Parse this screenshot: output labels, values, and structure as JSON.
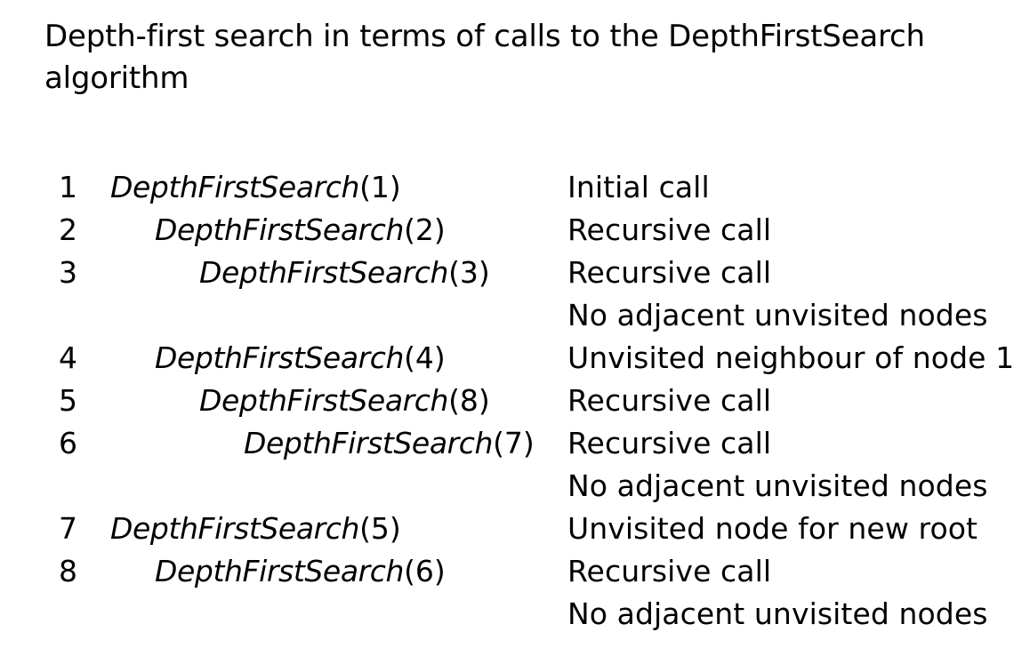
{
  "title": "Depth-first search in terms of calls to the DepthFirstSearch algorithm",
  "rows": [
    {
      "num": "1",
      "fn": "DepthFirstSearch",
      "arg": "(1)",
      "note": "Initial call"
    },
    {
      "num": "2",
      "fn": "DepthFirstSearch",
      "arg": "(2)",
      "note": "Recursive call"
    },
    {
      "num": "3",
      "fn": "DepthFirstSearch",
      "arg": "(3)",
      "note": "Recursive call"
    },
    {
      "note": "No adjacent unvisited nodes"
    },
    {
      "num": "4",
      "fn": "DepthFirstSearch",
      "arg": "(4)",
      "note": "Unvisited neighbour of node 1"
    },
    {
      "num": "5",
      "fn": "DepthFirstSearch",
      "arg": "(8)",
      "note": "Recursive call"
    },
    {
      "num": "6",
      "fn": "DepthFirstSearch",
      "arg": "(7)",
      "note": "Recursive call"
    },
    {
      "note": "No adjacent unvisited nodes"
    },
    {
      "num": "7",
      "fn": "DepthFirstSearch",
      "arg": "(5)",
      "note": "Unvisited node for new root"
    },
    {
      "num": "8",
      "fn": "DepthFirstSearch",
      "arg": "(6)",
      "note": "Recursive call"
    },
    {
      "note": "No adjacent unvisited nodes"
    }
  ]
}
